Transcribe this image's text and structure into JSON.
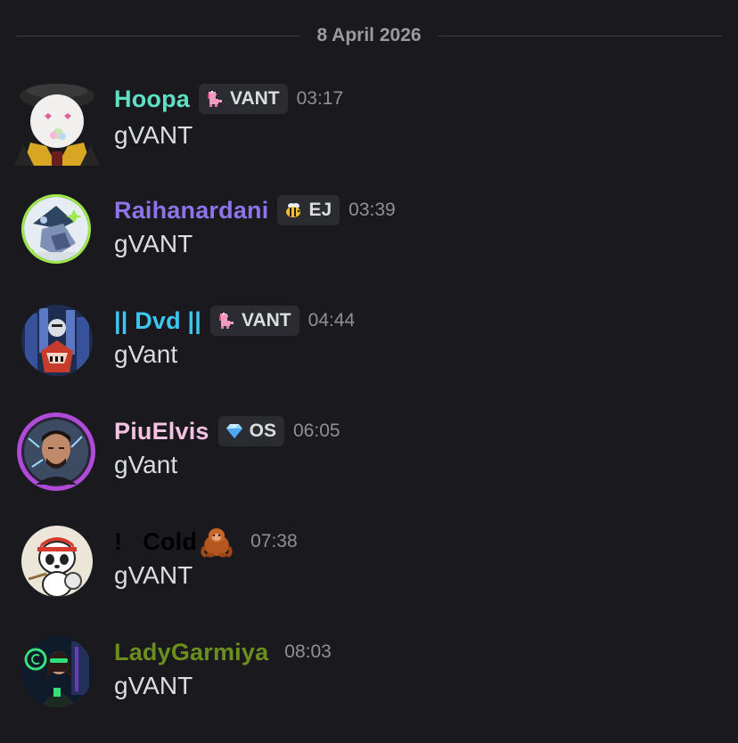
{
  "date_divider": "8 April 2026",
  "colors": {
    "background": "#1a1a1e",
    "hoopa": "#5de0c4",
    "raihanardani": "#8e73ea",
    "dvd": "#3dc6f0",
    "piuelvis": "#f3c2e2",
    "cold": "#000000",
    "ladygarmiya": "#6a8f1c"
  },
  "messages": [
    {
      "username": "Hoopa",
      "tag_icon": "pink-dino-icon",
      "tag": "VANT",
      "time": "03:17",
      "content": "gVANT"
    },
    {
      "username": "Raihanardani",
      "tag_icon": "bee-icon",
      "tag": "EJ",
      "time": "03:39",
      "content": "gVANT"
    },
    {
      "username": "|| Dvd ||",
      "tag_icon": "pink-dino-icon",
      "tag": "VANT",
      "time": "04:44",
      "content": "gVant"
    },
    {
      "username": "PiuElvis",
      "tag_icon": "diamond-icon",
      "tag": "OS",
      "time": "06:05",
      "content": "gVant"
    },
    {
      "username": "!   Cold",
      "username_emoji": "orangutan-emoji",
      "time": "07:38",
      "content": "gVANT"
    },
    {
      "username": "LadyGarmiya",
      "time": "08:03",
      "content": "gVANT"
    }
  ]
}
